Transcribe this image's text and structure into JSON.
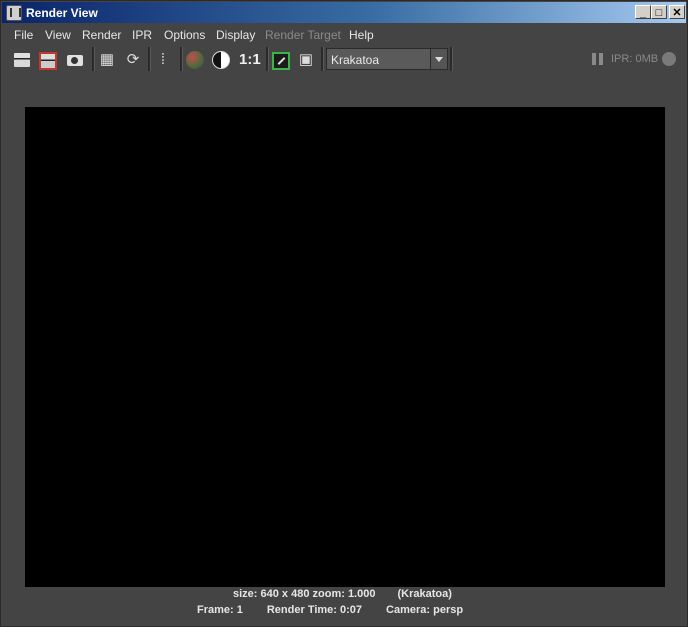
{
  "window": {
    "title": "Render View",
    "controls": {
      "minimize": "_",
      "maximize": "□",
      "close": "✕"
    }
  },
  "menu": [
    "File",
    "View",
    "Render",
    "IPR",
    "Options",
    "Display",
    "Render Target",
    "Help"
  ],
  "menu_disabled": [
    "Render Target"
  ],
  "toolbar": {
    "icons": [
      "render-frame-icon",
      "render-region-icon",
      "snapshot-icon",
      "redo-render-icon",
      "refresh-ipr-icon",
      "render-sequence-icon",
      "rgb-channels-icon",
      "alpha-channel-icon",
      "one-to-one-label",
      "keep-image-icon",
      "remove-image-icon"
    ],
    "ratio_label": "1:1",
    "renderer": "Krakatoa",
    "ipr_status": "IPR: 0MB"
  },
  "render_status": {
    "size": "size: 640 x 480 zoom: 1.000",
    "renderer_tag": "(Krakatoa)",
    "frame": "Frame: 1",
    "render_time": "Render Time: 0:07",
    "camera": "Camera: persp"
  },
  "colors": {
    "panel": "#444444",
    "render_area": "#000000",
    "title_start": "#0a246a",
    "title_end": "#a6caf0",
    "highlight_red": "#c0392b",
    "highlight_green": "#3bb54a"
  }
}
